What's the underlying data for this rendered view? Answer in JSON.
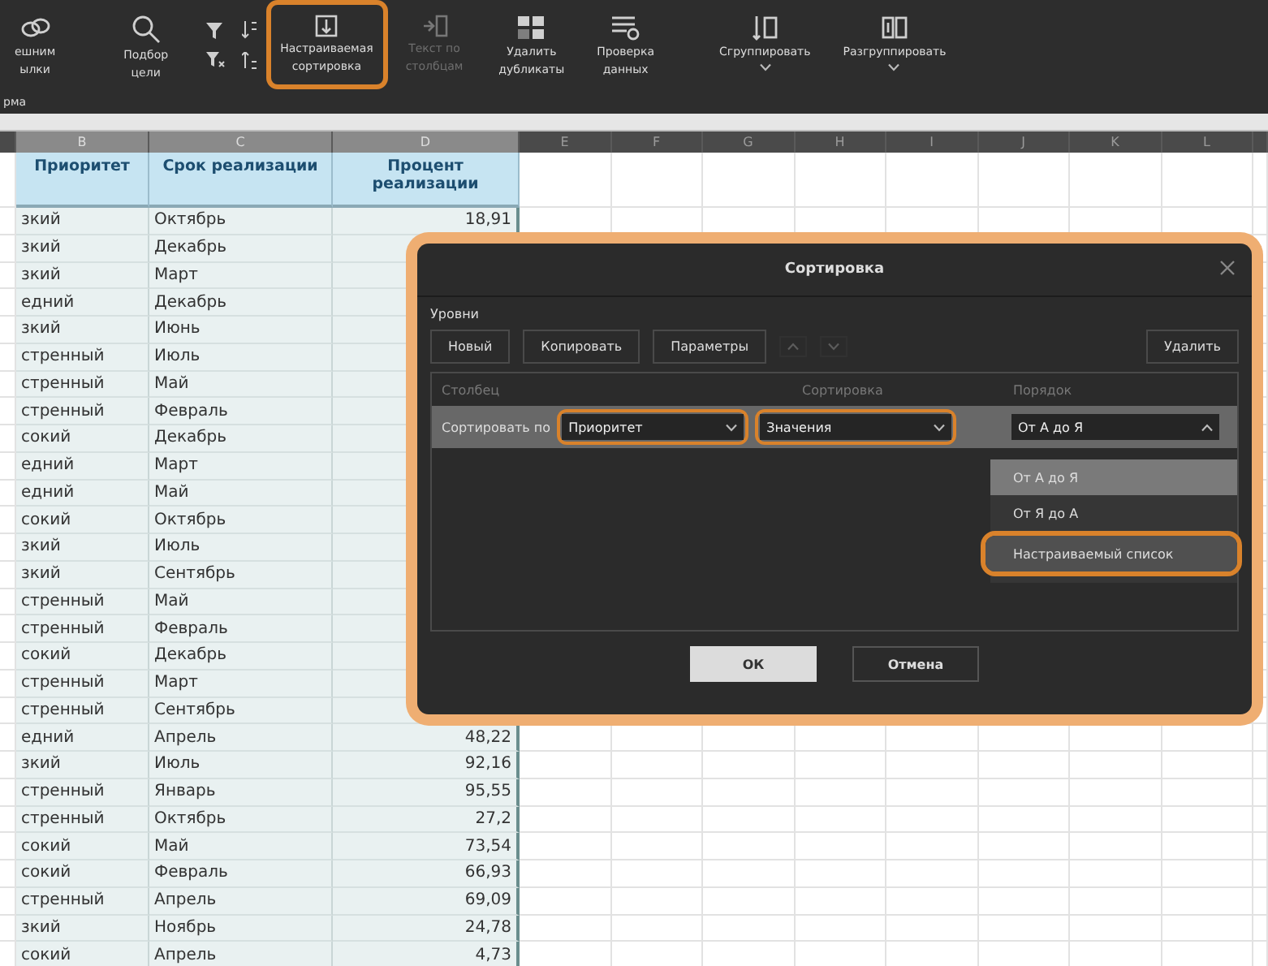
{
  "toolbar": {
    "items": [
      {
        "kind": "button",
        "label": [
          "ешним",
          "ылки"
        ],
        "disabled": false,
        "highlighted": false,
        "dropdown": false
      },
      {
        "kind": "button",
        "label": [
          "Подбор",
          "цели"
        ],
        "disabled": false,
        "highlighted": false,
        "dropdown": false
      },
      {
        "kind": "filter_pair"
      },
      {
        "kind": "sort_pair"
      },
      {
        "kind": "button",
        "label": [
          "Настраиваемая",
          "сортировка"
        ],
        "disabled": false,
        "highlighted": true,
        "dropdown": false
      },
      {
        "kind": "button",
        "label": [
          "Текст по",
          "столбцам"
        ],
        "disabled": true,
        "highlighted": false,
        "dropdown": false
      },
      {
        "kind": "button",
        "label": [
          "Удалить",
          "дубликаты"
        ],
        "disabled": false,
        "highlighted": false,
        "dropdown": false
      },
      {
        "kind": "button",
        "label": [
          "Проверка",
          "данных"
        ],
        "disabled": false,
        "highlighted": false,
        "dropdown": false
      },
      {
        "kind": "button",
        "label": [
          "Сгруппировать"
        ],
        "disabled": false,
        "highlighted": false,
        "dropdown": true
      },
      {
        "kind": "button",
        "label": [
          "Разгруппировать"
        ],
        "disabled": false,
        "highlighted": false,
        "dropdown": true
      }
    ]
  },
  "formula_bar": {
    "text": "рма"
  },
  "sheet": {
    "column_letters": [
      "B",
      "C",
      "D",
      "E",
      "F",
      "G",
      "H",
      "I",
      "J",
      "K",
      "L"
    ],
    "header": [
      "Приоритет",
      "Срок реализации",
      "Процент реализации"
    ],
    "rows": [
      [
        "зкий",
        "Октябрь",
        "18,91"
      ],
      [
        "зкий",
        "Декабрь"
      ],
      [
        "зкий",
        "Март"
      ],
      [
        "едний",
        "Декабрь"
      ],
      [
        "зкий",
        "Июнь"
      ],
      [
        "стренный",
        "Июль"
      ],
      [
        "стренный",
        "Май"
      ],
      [
        "стренный",
        "Февраль"
      ],
      [
        "сокий",
        "Декабрь"
      ],
      [
        "едний",
        "Март"
      ],
      [
        "едний",
        "Май"
      ],
      [
        "сокий",
        "Октябрь"
      ],
      [
        "зкий",
        "Июль"
      ],
      [
        "зкий",
        "Сентябрь"
      ],
      [
        "стренный",
        "Май"
      ],
      [
        "стренный",
        "Февраль"
      ],
      [
        "сокий",
        "Декабрь"
      ],
      [
        "стренный",
        "Март"
      ],
      [
        "стренный",
        "Сентябрь"
      ],
      [
        "едний",
        "Апрель",
        "48,22"
      ],
      [
        "зкий",
        "Июль",
        "92,16"
      ],
      [
        "стренный",
        "Январь",
        "95,55"
      ],
      [
        "стренный",
        "Октябрь",
        "27,2"
      ],
      [
        "сокий",
        "Май",
        "73,54"
      ],
      [
        "сокий",
        "Февраль",
        "66,93"
      ],
      [
        "стренный",
        "Апрель",
        "69,09"
      ],
      [
        "зкий",
        "Ноябрь",
        "24,78"
      ],
      [
        "сокий",
        "Апрель",
        "4,73"
      ]
    ]
  },
  "dialog": {
    "title": "Сортировка",
    "highlighted": true,
    "levels_label": "Уровни",
    "buttons": [
      {
        "label": "Новый"
      },
      {
        "label": "Копировать"
      },
      {
        "label": "Параметры"
      }
    ],
    "move_buttons": [
      {
        "kind": "up",
        "disabled": true
      },
      {
        "kind": "down",
        "disabled": true
      }
    ],
    "delete_button": "Удалить",
    "columns": [
      "Столбец",
      "Сортировка",
      "Порядок"
    ],
    "level": {
      "label": "Сортировать по",
      "column": {
        "value": "Приоритет",
        "highlighted": true
      },
      "sort_on": {
        "value": "Значения",
        "highlighted": true
      },
      "order": {
        "value": "От А до Я",
        "highlighted": false,
        "expanded": true
      }
    },
    "order_options": [
      {
        "label": "От А до Я",
        "selected": true,
        "highlighted": false
      },
      {
        "label": "От Я до А",
        "selected": false,
        "highlighted": false
      },
      {
        "label": "Настраиваемый список",
        "selected": false,
        "highlighted": true
      }
    ],
    "ok": "ОК",
    "cancel": "Отмена"
  }
}
